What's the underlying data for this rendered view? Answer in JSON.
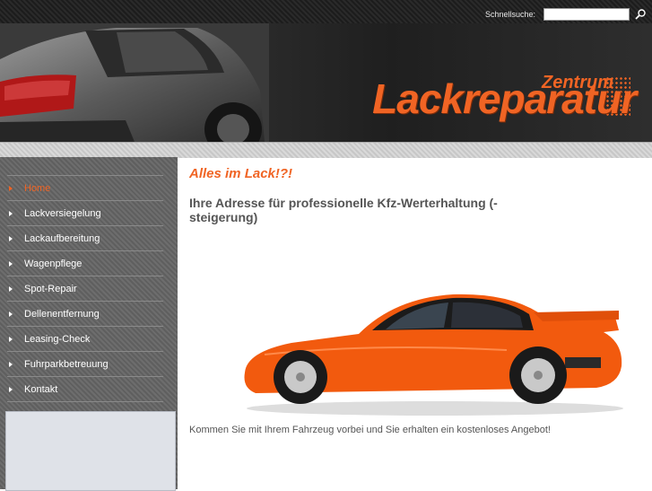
{
  "search": {
    "label": "Schnellsuche:",
    "placeholder": "",
    "button_icon": "search-icon"
  },
  "logo": {
    "sub": "Zentrum",
    "main": "Lackreparatur"
  },
  "nav": {
    "items": [
      {
        "label": "Home",
        "active": true
      },
      {
        "label": "Lackversiegelung"
      },
      {
        "label": "Lackaufbereitung"
      },
      {
        "label": "Wagenpflege"
      },
      {
        "label": "Spot-Repair"
      },
      {
        "label": "Dellenentfernung"
      },
      {
        "label": "Leasing-Check"
      },
      {
        "label": "Fuhrparkbetreuung"
      },
      {
        "label": "Kontakt"
      }
    ]
  },
  "main": {
    "headline": "Alles im Lack!?!",
    "subheadline": "Ihre Adresse für professionelle Kfz-Werterhaltung (-steigerung)",
    "caption": "Kommen Sie mit Ihrem Fahrzeug vorbei und Sie erhalten ein kostenloses Angebot!"
  },
  "colors": {
    "accent": "#f06424",
    "sidebar": "#666666",
    "text": "#555555"
  }
}
